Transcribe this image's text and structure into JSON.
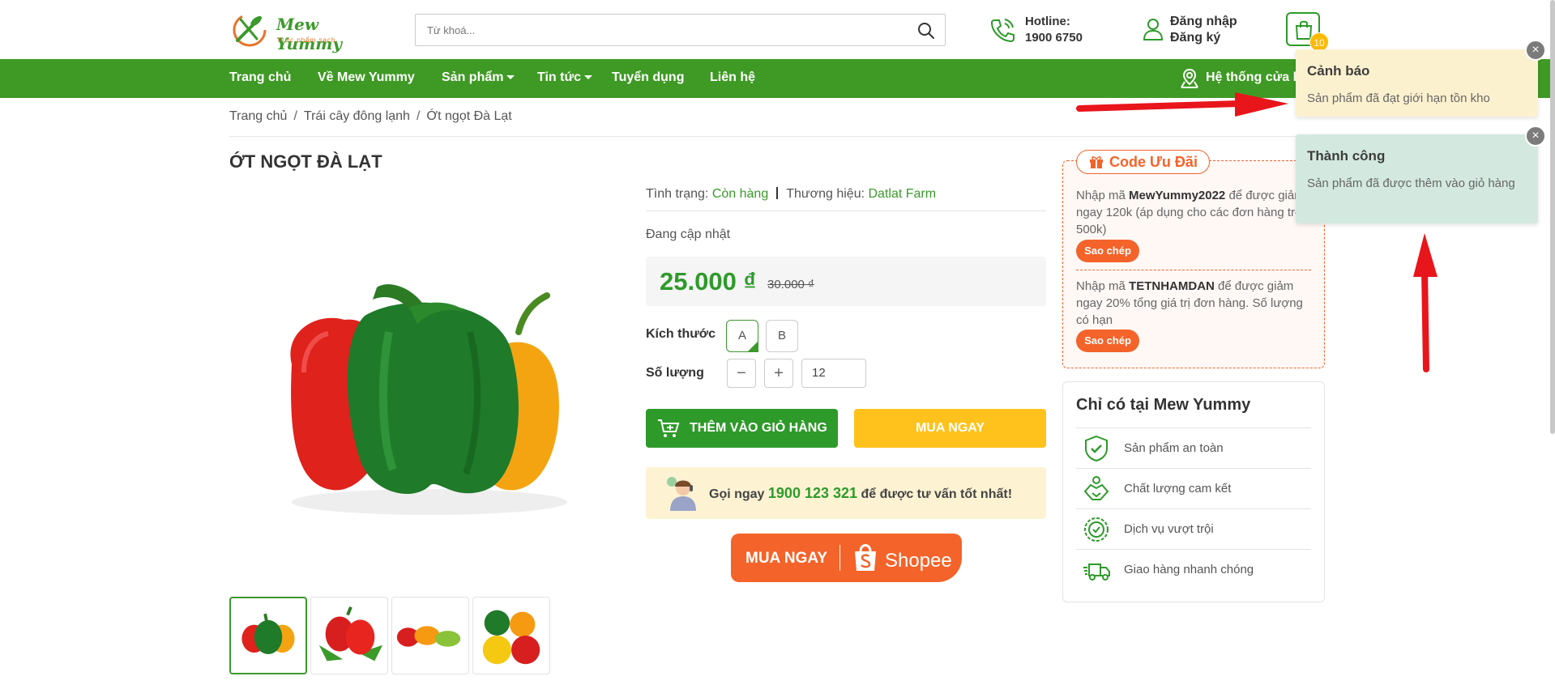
{
  "brand": {
    "name": "Mew Yummy",
    "tagline": "thực phẩm sạch"
  },
  "search": {
    "placeholder": "Từ khoá..."
  },
  "hotline": {
    "label": "Hotline:",
    "number": "1900 6750"
  },
  "account": {
    "login": "Đăng nhập",
    "register": "Đăng ký"
  },
  "cart": {
    "count": "10"
  },
  "nav": {
    "items": [
      "Trang chủ",
      "Về Mew Yummy",
      "Sản phẩm",
      "Tin tức",
      "Tuyển dụng",
      "Liên hệ"
    ],
    "store": "Hệ thống cửa h"
  },
  "breadcrumb": [
    "Trang chủ",
    "Trái cây đông lạnh",
    "Ớt ngọt Đà Lạt"
  ],
  "product": {
    "title": "ỚT NGỌT ĐÀ LẠT",
    "status_label": "Tình trạng:",
    "status_value": "Còn hàng",
    "brand_label": "Thương hiệu:",
    "brand_value": "Datlat Farm",
    "update_note": "Đang cập nhật",
    "price": "25.000 ₫",
    "old_price": "30.000 ₫",
    "size_label": "Kích thước",
    "sizes": [
      "A",
      "B"
    ],
    "selected_size": "A",
    "qty_label": "Số lượng",
    "qty_minus": "−",
    "qty_plus": "+",
    "quantity": "12",
    "add_to_cart": "THÊM VÀO GIỎ HÀNG",
    "buy_now": "MUA NGAY",
    "call_pre": "Gọi ngay",
    "call_number": "1900 123 321",
    "call_post": "để được tư vấn tốt nhất!",
    "shopee_buy": "MUA NGAY",
    "shopee_brand": "Shopee"
  },
  "codes": {
    "title": "Code Ưu Đãi",
    "code1_pre": "Nhập mã",
    "code1_code": "MewYummy2022",
    "code1_post": "để được giảm ngay 120k (áp dụng cho các đơn hàng trên 500k)",
    "code2_pre": "Nhập mã",
    "code2_code": "TETNHAMDAN",
    "code2_post": "để được giảm ngay 20% tổng giá trị đơn hàng. Số lượng có hạn",
    "copy": "Sao chép"
  },
  "only": {
    "title": "Chỉ có tại Mew Yummy",
    "features": [
      "Sản phẩm an toàn",
      "Chất lượng cam kết",
      "Dịch vụ vượt trội",
      "Giao hàng nhanh chóng"
    ]
  },
  "toasts": {
    "warn_title": "Cảnh báo",
    "warn_msg": "Sản phẩm đã đạt giới hạn tồn kho",
    "ok_title": "Thành công",
    "ok_msg": "Sản phẩm đã được thêm vào giỏ hàng",
    "close": "×"
  },
  "colors": {
    "primary": "#3f9a25",
    "accent": "#f4632a",
    "buy": "#ffc21d",
    "arrow": "#e8151b"
  },
  "icons": [
    "logo-icon",
    "search-icon",
    "phone-icon",
    "user-icon",
    "cart-icon",
    "map-pin-icon",
    "cart-add-icon",
    "support-agent-icon",
    "shopee-bag-icon",
    "gift-icon",
    "shield-check-icon",
    "handshake-icon",
    "badge-check-icon",
    "truck-icon"
  ]
}
